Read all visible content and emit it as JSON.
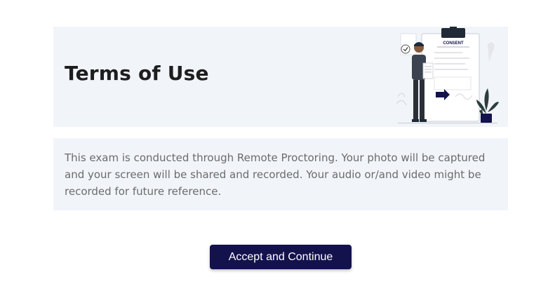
{
  "hero": {
    "title": "Terms of Use",
    "illustration_icon": "consent-clipboard-illustration",
    "illustration_label": "CONSENT"
  },
  "notice": {
    "text": "This exam is conducted through Remote Proctoring. Your photo will be captured and your screen will be shared and recorded. Your audio or/and video might be recorded for future reference."
  },
  "actions": {
    "accept_label": "Accept and Continue"
  },
  "colors": {
    "panel_background": "#f1f4f9",
    "button_background": "#14124d",
    "button_text": "#ffffff",
    "title_text": "#1e1e1e",
    "body_text": "#6b6b6b"
  }
}
